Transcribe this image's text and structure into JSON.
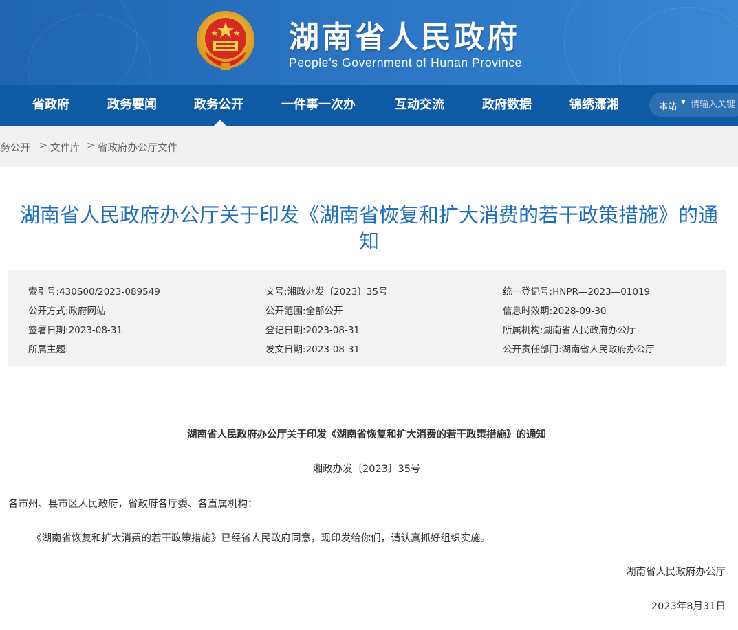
{
  "header": {
    "title": "湖南省人民政府",
    "subtitle": "People’s Government of Hunan Province",
    "emblem_icon": "national-emblem-icon"
  },
  "nav": {
    "items": [
      "省政府",
      "政务要闻",
      "政务公开",
      "一件事一次办",
      "互动交流",
      "政府数据",
      "锦绣潇湘"
    ],
    "active": "政务公开"
  },
  "search": {
    "scope": "本站",
    "placeholder": "请输入关键"
  },
  "breadcrumb": [
    "政务公开",
    "文件库",
    "省政府办公厅文件"
  ],
  "breadcrumb_separator": ">",
  "document": {
    "title_line1": "湖南省人民政府办公厅关于印发《湖南省恢复和扩大消费的若干政策措施》的通",
    "title_line2": "知",
    "meta": {
      "index_label": "索引号:",
      "index_value": "430S00/2023-089549",
      "doc_no_label": "文号:",
      "doc_no_value": "湘政办发〔2023〕35号",
      "reg_no_label": "统一登记号:",
      "reg_no_value": "HNPR—2023—01019",
      "method_label": "公开方式:",
      "method_value": "政府网站",
      "scope_label": "公开范围:",
      "scope_value": "全部公开",
      "validity_label": "信息时效期:",
      "validity_value": "2028-09-30",
      "sign_date_label": "签署日期:",
      "sign_date_value": "2023-08-31",
      "record_date_label": "登记日期:",
      "record_date_value": "2023-08-31",
      "org_label": "所属机构:",
      "org_value": "湖南省人民政府办公厅",
      "topic_label": "所属主题:",
      "topic_value": "",
      "issue_date_label": "发文日期:",
      "issue_date_value": "2023-08-31",
      "dept_label": "公开责任部门:",
      "dept_value": "湖南省人民政府办公厅"
    },
    "heading": "湖南省人民政府办公厅关于印发《湖南省恢复和扩大消费的若干政策措施》的通知",
    "number": "湘政办发〔2023〕35号",
    "recipients": "各市州、县市区人民政府，省政府各厅委、各直属机构：",
    "paragraph": "《湖南省恢复和扩大消费的若干政策措施》已经省人民政府同意，现印发给你们，请认真抓好组织实施。",
    "signer": "湖南省人民政府办公厅",
    "date": "2023年8月31日"
  },
  "colors": {
    "nav_bg": "#0f5aa5",
    "title_blue": "#1f6fbe",
    "meta_bg": "#f2f2f2",
    "crumb_bg": "#f1f1f1"
  }
}
